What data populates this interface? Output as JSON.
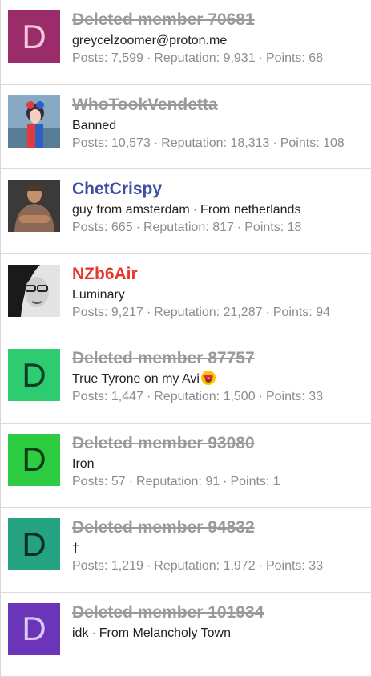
{
  "members": [
    {
      "name": "Deleted member 70681",
      "style": "deleted",
      "avatar_letter": "D",
      "avatar_bg": "#9b2c6a",
      "avatar_fg": "#f3c6dc",
      "avatar_kind": "letter",
      "description": [
        "greycelzoomer@proton.me"
      ],
      "stats": {
        "posts": "Posts: 7,599",
        "reputation": "Reputation: 9,931",
        "points": "Points: 68"
      }
    },
    {
      "name": "WhoTookVendetta",
      "style": "banned",
      "avatar_kind": "photo",
      "avatar_bg": "#7ea3bf",
      "avatar_photo": "clown-woman-photo",
      "description": [
        "Banned"
      ],
      "stats": {
        "posts": "Posts: 10,573",
        "reputation": "Reputation: 18,313",
        "points": "Points: 108"
      }
    },
    {
      "name": "ChetCrispy",
      "style": "normal",
      "avatar_kind": "photo",
      "avatar_bg": "#7d6a5a",
      "avatar_photo": "man-crossed-arms-photo",
      "description": [
        "guy from amsterdam",
        "From netherlands"
      ],
      "stats": {
        "posts": "Posts: 665",
        "reputation": "Reputation: 817",
        "points": "Points: 18"
      }
    },
    {
      "name": "NZb6Air",
      "style": "red",
      "avatar_kind": "photo",
      "avatar_bg": "#d9d9d9",
      "avatar_photo": "woman-glasses-bw-photo",
      "description": [
        "Luminary"
      ],
      "stats": {
        "posts": "Posts: 9,217",
        "reputation": "Reputation: 21,287",
        "points": "Points: 94"
      }
    },
    {
      "name": "Deleted member 87757",
      "style": "deleted",
      "avatar_letter": "D",
      "avatar_bg": "#2ecc71",
      "avatar_fg": "#0d3d20",
      "avatar_kind": "letter",
      "description": [
        "True Tyrone on my Avi"
      ],
      "has_emoji": true,
      "emoji_name": "heart-eyes-emoji",
      "stats": {
        "posts": "Posts: 1,447",
        "reputation": "Reputation: 1,500",
        "points": "Points: 33"
      }
    },
    {
      "name": "Deleted member 93080",
      "style": "deleted",
      "avatar_letter": "D",
      "avatar_bg": "#2ecc40",
      "avatar_fg": "#0d3d14",
      "avatar_kind": "letter",
      "description": [
        "Iron"
      ],
      "stats": {
        "posts": "Posts: 57",
        "reputation": "Reputation: 91",
        "points": "Points: 1"
      }
    },
    {
      "name": "Deleted member 94832",
      "style": "deleted",
      "avatar_letter": "D",
      "avatar_bg": "#25a27f",
      "avatar_fg": "#0a2f24",
      "avatar_kind": "letter",
      "description": [
        "†"
      ],
      "stats": {
        "posts": "Posts: 1,219",
        "reputation": "Reputation: 1,972",
        "points": "Points: 33"
      }
    },
    {
      "name": "Deleted member 101934",
      "style": "deleted",
      "avatar_letter": "D",
      "avatar_bg": "#6a35b8",
      "avatar_fg": "#d9c8f2",
      "avatar_kind": "letter",
      "description": [
        "idk",
        "From Melancholy Town"
      ],
      "stats": {
        "posts": "",
        "reputation": "",
        "points": ""
      }
    }
  ]
}
